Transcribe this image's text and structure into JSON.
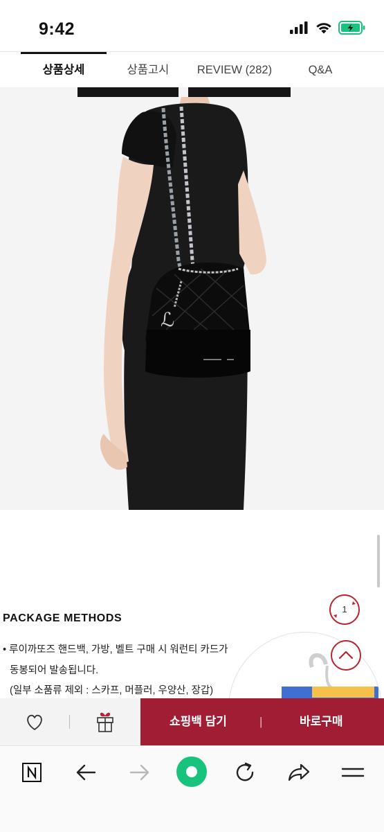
{
  "status_bar": {
    "time": "9:42",
    "icons": [
      "signal-icon",
      "wifi-icon",
      "battery-charging-icon"
    ]
  },
  "tabs": [
    {
      "label": "상품상세",
      "active": true
    },
    {
      "label": "상품고시",
      "active": false
    },
    {
      "label": "REVIEW (282)",
      "active": false
    },
    {
      "label": "Q&A",
      "active": false
    }
  ],
  "hero": {
    "image": "model-with-black-bucket-bag"
  },
  "package": {
    "title": "PACKAGE METHODS",
    "lines": [
      "• 루이까또즈 핸드백, 가방, 벨트 구매 시 워런티 카드가",
      "동봉되어 발송됩니다.",
      "(일부 소품류 제외 : 스카프, 머플러, 우양산, 장갑)"
    ]
  },
  "floating": {
    "page_indicator": "1"
  },
  "actions": {
    "buy_bag": "쇼핑백 담기",
    "buy_now": "바로구매",
    "divider": "|"
  },
  "browser": {
    "icons": [
      "naver-icon",
      "back-icon",
      "forward-icon",
      "green-dot-icon",
      "refresh-icon",
      "share-icon",
      "menu-icon"
    ]
  },
  "colors": {
    "accent": "#a11d33",
    "red": "#b8232f",
    "green": "#19c37d"
  }
}
